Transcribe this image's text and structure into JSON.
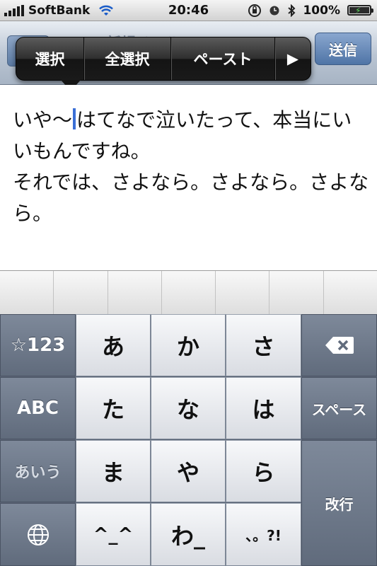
{
  "status": {
    "carrier": "SoftBank",
    "time": "20:46",
    "battery": "100%"
  },
  "nav": {
    "title": "新規メール",
    "send_label": "送信"
  },
  "popup": {
    "items": [
      "選択",
      "全選択",
      "ペースト",
      "▶"
    ]
  },
  "editor": {
    "text_before_caret": "いや〜",
    "text_after_caret": "はてなで泣いたって、本当にいいもんですね。\nそれでは、さよなら。さよなら。さよなら。"
  },
  "keyboard": {
    "symbols_label": "☆123",
    "abc_label": "ABC",
    "kana_label": "あいう",
    "globe_icon": "globe-icon",
    "space_label": "スペース",
    "return_label": "改行",
    "delete_icon": "delete-icon",
    "keys": [
      "あ",
      "か",
      "さ",
      "た",
      "な",
      "は",
      "ま",
      "や",
      "ら",
      "^_^",
      "わ_",
      "、。?!"
    ]
  }
}
